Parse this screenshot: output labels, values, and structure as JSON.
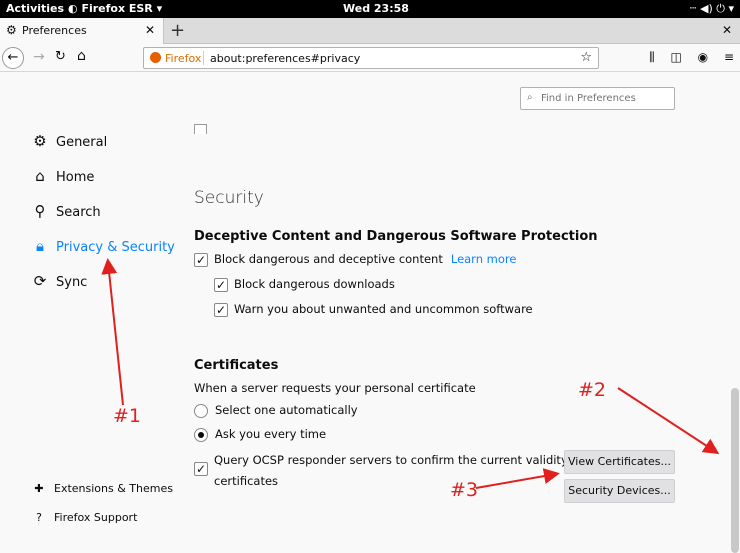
{
  "topbar": {
    "activities": "Activities",
    "app_menu": "Firefox ESR ▾",
    "clock": "Wed 23:58",
    "tray": "ⵈ ◀) ⏻ ▾"
  },
  "tabs": [
    {
      "title": "Preferences",
      "icon": "gear-icon"
    }
  ],
  "navbar": {
    "identity": "Firefox",
    "url": "about:preferences#privacy"
  },
  "search": {
    "placeholder": "Find in Preferences"
  },
  "sidebar": {
    "items": [
      {
        "label": "General",
        "icon": "gear-icon"
      },
      {
        "label": "Home",
        "icon": "home-icon"
      },
      {
        "label": "Search",
        "icon": "search-icon"
      },
      {
        "label": "Privacy & Security",
        "icon": "lock-icon",
        "selected": true
      },
      {
        "label": "Sync",
        "icon": "sync-icon"
      }
    ],
    "footer": [
      {
        "label": "Extensions & Themes",
        "icon": "puzzle-icon"
      },
      {
        "label": "Firefox Support",
        "icon": "help-icon"
      }
    ]
  },
  "security": {
    "title": "Security",
    "deceptive": {
      "title": "Deceptive Content and Dangerous Software Protection",
      "block_deceptive": "Block dangerous and deceptive content",
      "learn_more": "Learn more",
      "block_downloads": "Block dangerous downloads",
      "warn_unwanted": "Warn you about unwanted and uncommon software"
    },
    "certificates": {
      "title": "Certificates",
      "description": "When a server requests your personal certificate",
      "select_auto": "Select one automatically",
      "ask_every_time": "Ask you every time",
      "ocsp_line1": "Query OCSP responder servers to confirm the current validity of",
      "ocsp_line2": "certificates",
      "view_certificates": "View Certificates...",
      "security_devices": "Security Devices..."
    }
  },
  "annotations": {
    "label1": "#1",
    "label2": "#2",
    "label3": "#3",
    "color": "#e0201f"
  }
}
